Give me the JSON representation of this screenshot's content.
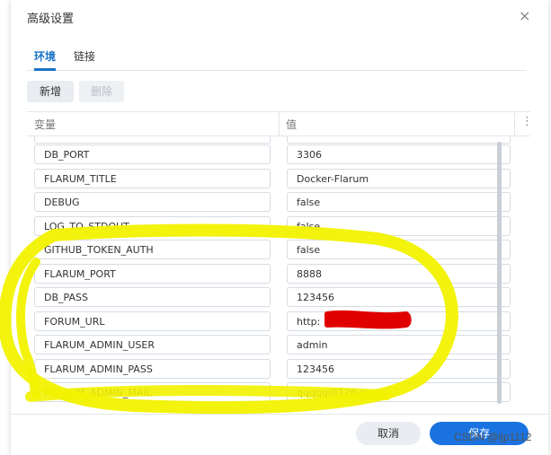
{
  "dialog": {
    "title": "高级设置",
    "close_glyph": "×"
  },
  "tabs": [
    {
      "label": "环境",
      "active": true
    },
    {
      "label": "链接",
      "active": false
    }
  ],
  "toolbar": {
    "add_label": "新增",
    "delete_label": "删除"
  },
  "grid": {
    "col_variable": "变量",
    "col_value": "值",
    "menu_glyph": "⋮",
    "rows": [
      {
        "key": "",
        "value": ""
      },
      {
        "key": "DB_PORT",
        "value": "3306"
      },
      {
        "key": "FLARUM_TITLE",
        "value": "Docker-Flarum"
      },
      {
        "key": "DEBUG",
        "value": "false"
      },
      {
        "key": "LOG_TO_STDOUT",
        "value": "false"
      },
      {
        "key": "GITHUB_TOKEN_AUTH",
        "value": "false"
      },
      {
        "key": "FLARUM_PORT",
        "value": "8888"
      },
      {
        "key": "DB_PASS",
        "value": "123456"
      },
      {
        "key": "FORUM_URL",
        "value": "http:                :8888"
      },
      {
        "key": "FLARUM_ADMIN_USER",
        "value": "admin"
      },
      {
        "key": "FLARUM_ADMIN_PASS",
        "value": "123456"
      },
      {
        "key": "FLARUM_ADMIN_MAIL",
        "value": "qqqqq@126.com"
      }
    ]
  },
  "footer": {
    "cancel_label": "取消",
    "save_label": "保存"
  },
  "watermark": "CSDN @ljp1112",
  "colors": {
    "accent": "#1a73e0",
    "highlight": "#f2f200",
    "redact": "#e00000"
  }
}
